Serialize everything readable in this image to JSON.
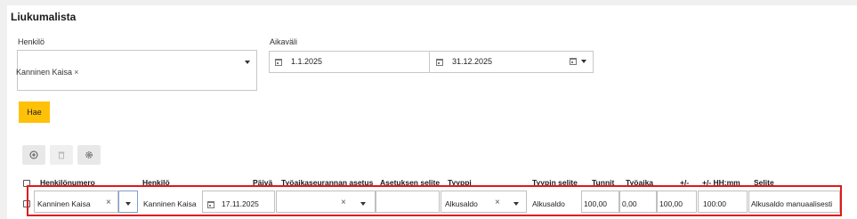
{
  "page": {
    "title": "Liukumalista"
  },
  "filters": {
    "person_label": "Henkilö",
    "selected_person": "Kanninen Kaisa",
    "period_label": "Aikaväli",
    "date_from": "1.1.2025",
    "date_to": "31.12.2025",
    "search_button": "Hae"
  },
  "toolbar": {
    "icons": [
      "add-icon",
      "delete-icon",
      "settings-icon"
    ]
  },
  "table": {
    "headers": {
      "employee_number": "Henkilönumero",
      "person": "Henkilö",
      "date": "Päivä",
      "tracking_setting": "Työaikaseurannan asetus",
      "setting_desc": "Asetuksen selite",
      "type": "Tyyppi",
      "type_desc": "Tyypin selite",
      "hours": "Tunnit",
      "worktime": "Työaika",
      "plusminus": "+/-",
      "plusminus_hhmm": "+/- HH:mm",
      "description": "Selite"
    },
    "row": {
      "employee": "Kanninen Kaisa",
      "person": "Kanninen Kaisa",
      "date": "17.11.2025",
      "tracking_setting": "",
      "setting_desc": "",
      "type": "Alkusaldo",
      "type_desc": "Alkusaldo",
      "hours": "100,00",
      "worktime": "0,00",
      "plusminus": "100,00",
      "plusminus_hhmm": "100:00",
      "description": "Alkusaldo manuaalisesti"
    }
  },
  "colors": {
    "accent": "#ffc107",
    "highlight": "#e0191a"
  }
}
